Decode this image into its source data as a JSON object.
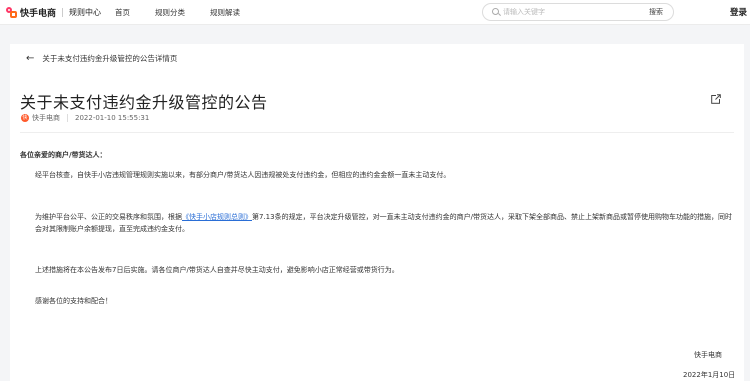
{
  "header": {
    "brand": "快手电商",
    "sub_brand": "规则中心",
    "nav": [
      "首页",
      "规则分类",
      "规则解读"
    ],
    "search": {
      "placeholder": "请输入关键字",
      "button": "搜索"
    },
    "login": "登录"
  },
  "page": {
    "back_label": "关于未支付违约金升级管控的公告详情页",
    "title": "关于未支付违约金升级管控的公告",
    "author": "快手电商",
    "publish_time": "2022-01-10 15:55:31",
    "avatar_text": "快"
  },
  "content": {
    "greeting": "各位亲爱的商户/带货达人：",
    "para1": "经平台核查，自快手小店违规管理规则实施以来，有部分商户/带货达人因违规被处支付违约金，但相应的违约金金额一直未主动支付。",
    "para2_before": "为维护平台公平、公正的交易秩序和氛围，根据",
    "para2_link": "《快手小店规则总则》",
    "para2_after": "第7.13条的规定，平台决定升级管控，对一直未主动支付违约金的商户/带货达人，采取下架全部商品、禁止上架新商品或暂停使用购物车功能的措施，同时会对其限制账户余额提现，直至完成违约金支付。",
    "para3": "上述措施将在本公告发布7日后实施。请各位商户/带货达人自查并尽快主动支付，避免影响小店正常经营或带货行为。",
    "para4": "感谢各位的支持和配合！",
    "signature": "快手电商",
    "sign_date": "2022年1月10日"
  },
  "colors": {
    "brand_red": "#fe3666",
    "brand_orange": "#ff6a1a",
    "link": "#2a6ed6"
  }
}
